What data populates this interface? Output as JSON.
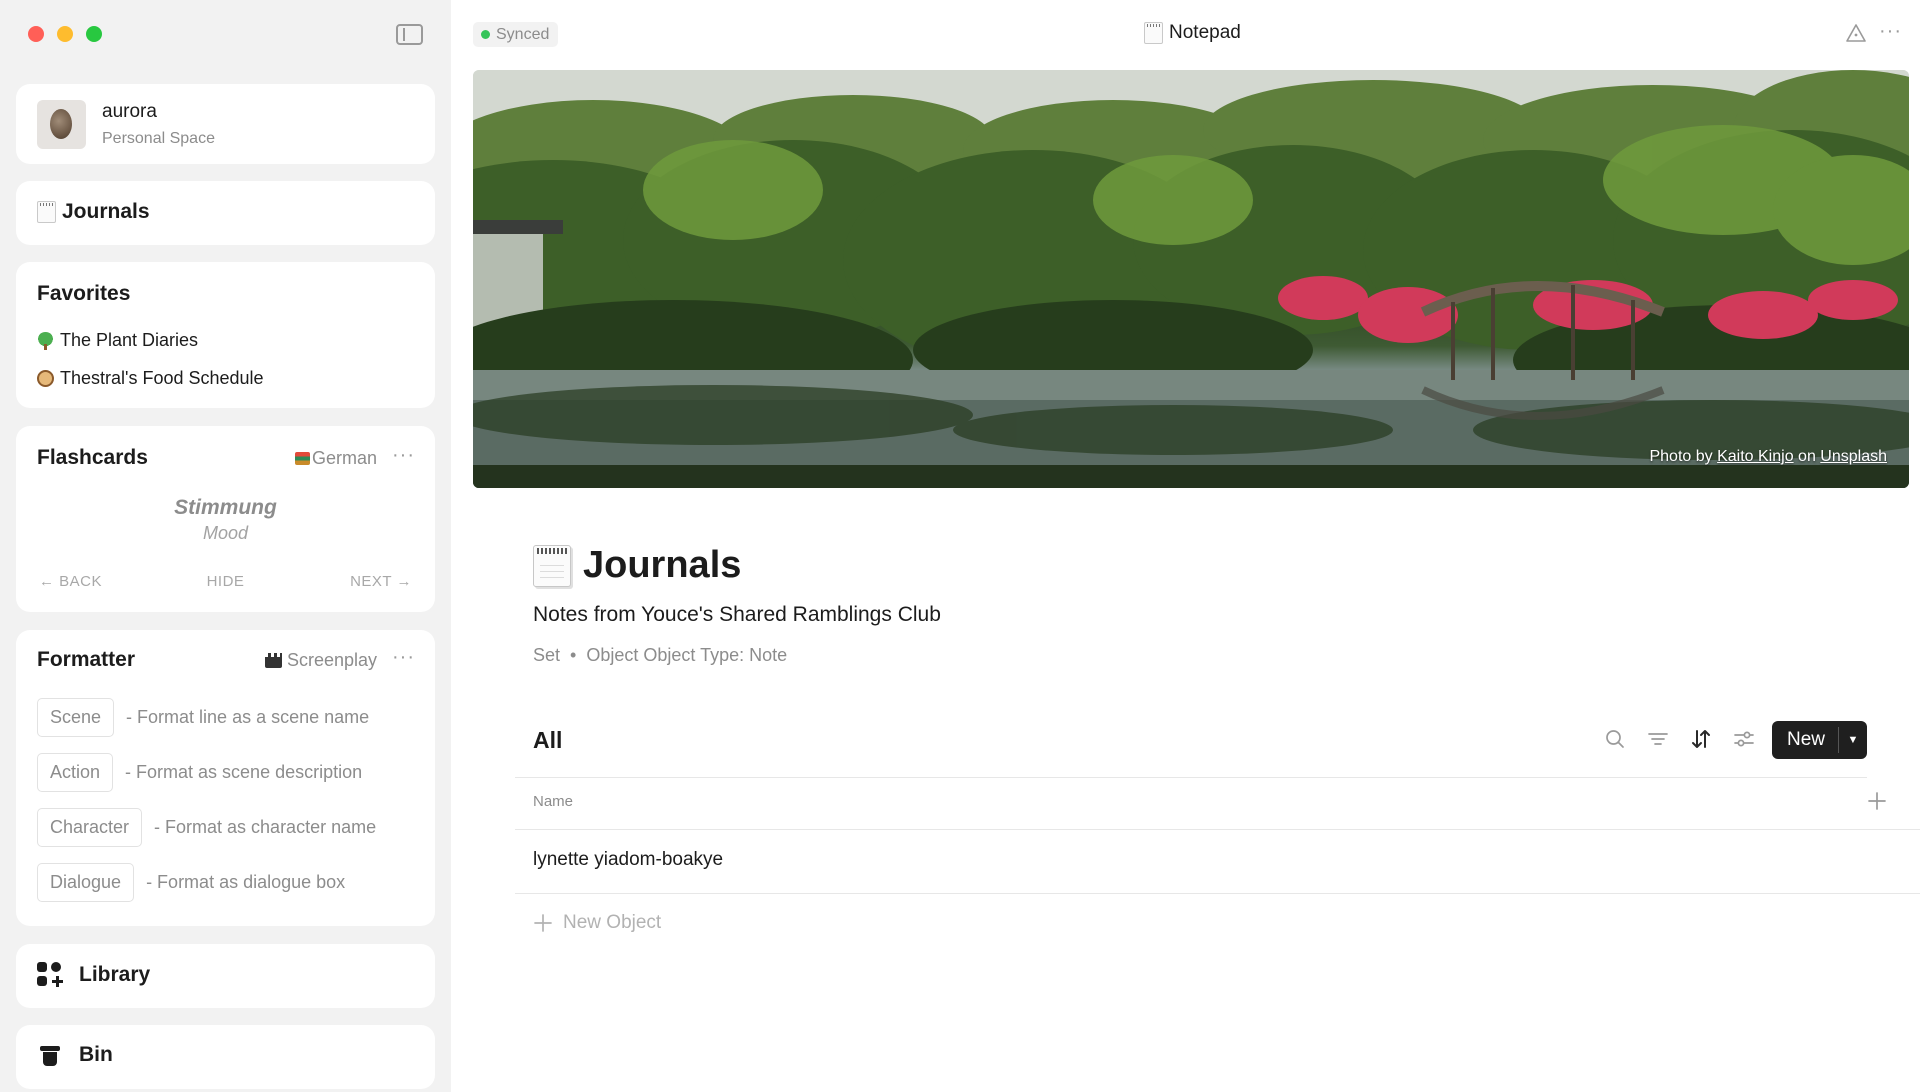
{
  "account": {
    "name": "aurora",
    "subtitle": "Personal Space"
  },
  "sidebar_journals": {
    "label": "Journals"
  },
  "favorites": {
    "title": "Favorites",
    "items": [
      {
        "label": "The Plant Diaries",
        "icon": "tree-icon"
      },
      {
        "label": "Thestral's Food Schedule",
        "icon": "dog-face-icon"
      }
    ]
  },
  "flashcards": {
    "title": "Flashcards",
    "deck": "German",
    "word": "Stimmung",
    "translation": "Mood",
    "back": "← BACK",
    "hide": "HIDE",
    "next": "NEXT →"
  },
  "formatter": {
    "title": "Formatter",
    "mode": "Screenplay",
    "rows": [
      {
        "tag": "Scene",
        "desc": "- Format line as a scene name"
      },
      {
        "tag": "Action",
        "desc": "- Format as scene description"
      },
      {
        "tag": "Character",
        "desc": "- Format as character name"
      },
      {
        "tag": "Dialogue",
        "desc": "- Format as dialogue box"
      }
    ]
  },
  "library": {
    "label": "Library"
  },
  "bin": {
    "label": "Bin"
  },
  "topbar": {
    "status": "Synced",
    "title": "Notepad"
  },
  "cover": {
    "credit_prefix": "Photo by",
    "credit_author": "Kaito Kinjo",
    "credit_mid": "on",
    "credit_source": "Unsplash"
  },
  "page": {
    "title": "Journals",
    "description": "Notes from Youce's Shared Ramblings Club",
    "meta_kind": "Set",
    "meta_sep": "•",
    "meta_type": "Object Object Type: Note"
  },
  "view": {
    "title": "All",
    "new_label": "New",
    "column_name": "Name",
    "rows": [
      "lynette yiadom-boakye"
    ],
    "new_object": "New Object"
  },
  "colors": {
    "synced_dot": "#36c45a",
    "new_button_bg": "#1f1f1f",
    "sidebar_bg": "#f2f2f2"
  }
}
